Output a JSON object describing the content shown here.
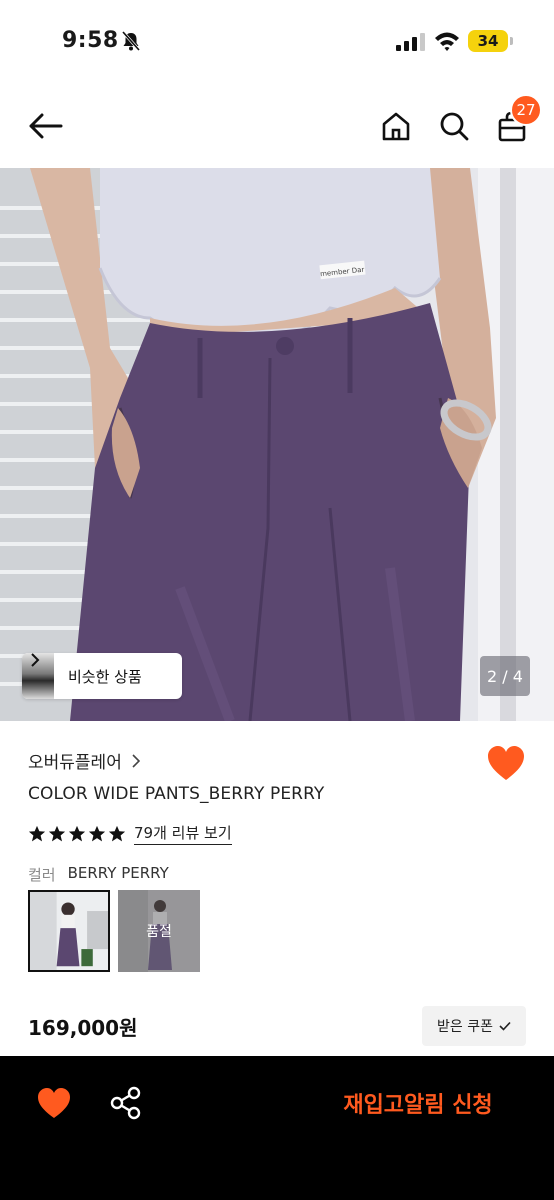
{
  "status_bar": {
    "time": "9:58",
    "battery": "34"
  },
  "header": {
    "cart_count": "27"
  },
  "product_image": {
    "similar_products_label": "비슷한 상품",
    "page_counter": "2 / 4",
    "shirt_tag_text": "member Dar"
  },
  "product": {
    "brand": "오버듀플레어",
    "title": "COLOR WIDE PANTS_BERRY PERRY",
    "rating_stars": 5,
    "review_link": "79개 리뷰 보기",
    "color_key": "컬러",
    "color_value": "BERRY PERRY",
    "soldout_label": "품절",
    "price": "169,000원",
    "coupon_label": "받은 쿠폰"
  },
  "bottom_bar": {
    "restock_label": "재입고알림 신청"
  },
  "colors": {
    "accent": "#ff5a1f",
    "battery": "#f5d20d",
    "pants": "#5b4770",
    "shirt": "#d9d9e6"
  }
}
